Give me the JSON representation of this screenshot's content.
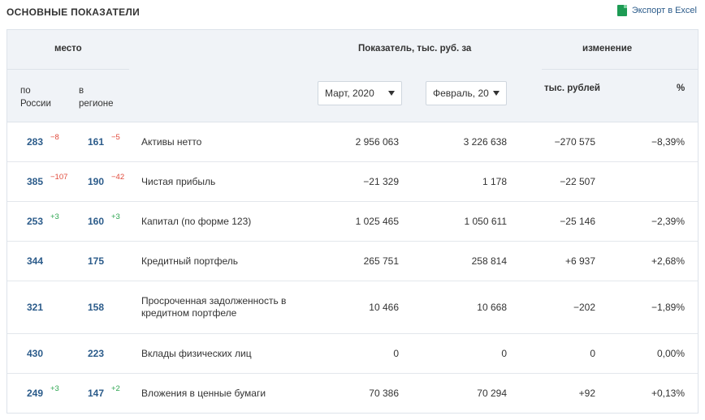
{
  "header": {
    "title": "ОСНОВНЫЕ ПОКАЗАТЕЛИ",
    "export_label": "Экспорт в Excel"
  },
  "columns": {
    "place": "место",
    "russia": [
      "по",
      "России"
    ],
    "region": [
      "в",
      "регионе"
    ],
    "indicator": "Показатель, тыс. руб. за",
    "change": "изменение",
    "change_thousand": "тыс. рублей",
    "change_percent": "%",
    "period1": "Март, 2020",
    "period2": "Февраль, 20"
  },
  "rows": [
    {
      "rank_ru": "283",
      "delta_ru": "−8",
      "rank_reg": "161",
      "delta_reg": "−5",
      "name": "Активы нетто",
      "v1": "2 956 063",
      "v2": "3 226 638",
      "chg": "−270 575",
      "pct": "−8,39%"
    },
    {
      "rank_ru": "385",
      "delta_ru": "−107",
      "rank_reg": "190",
      "delta_reg": "−42",
      "name": "Чистая прибыль",
      "v1": "−21 329",
      "v2": "1 178",
      "chg": "−22 507",
      "pct": ""
    },
    {
      "rank_ru": "253",
      "delta_ru": "+3",
      "rank_reg": "160",
      "delta_reg": "+3",
      "name": "Капитал (по форме 123)",
      "v1": "1 025 465",
      "v2": "1 050 611",
      "chg": "−25 146",
      "pct": "−2,39%"
    },
    {
      "rank_ru": "344",
      "delta_ru": "",
      "rank_reg": "175",
      "delta_reg": "",
      "name": "Кредитный портфель",
      "v1": "265 751",
      "v2": "258 814",
      "chg": "+6 937",
      "pct": "+2,68%"
    },
    {
      "rank_ru": "321",
      "delta_ru": "",
      "rank_reg": "158",
      "delta_reg": "",
      "name": [
        "Просроченная задолженность в",
        "кредитном портфеле"
      ],
      "v1": "10 466",
      "v2": "10 668",
      "chg": "−202",
      "pct": "−1,89%"
    },
    {
      "rank_ru": "430",
      "delta_ru": "",
      "rank_reg": "223",
      "delta_reg": "",
      "name": "Вклады физических лиц",
      "v1": "0",
      "v2": "0",
      "chg": "0",
      "pct": "0,00%"
    },
    {
      "rank_ru": "249",
      "delta_ru": "+3",
      "rank_reg": "147",
      "delta_reg": "+2",
      "name": "Вложения в ценные бумаги",
      "v1": "70 386",
      "v2": "70 294",
      "chg": "+92",
      "pct": "+0,13%"
    }
  ],
  "colors": {
    "negative": "#e04a3b",
    "positive": "#2ea651",
    "rank": "#2b5b8a",
    "header_bg": "#f0f3f7"
  }
}
